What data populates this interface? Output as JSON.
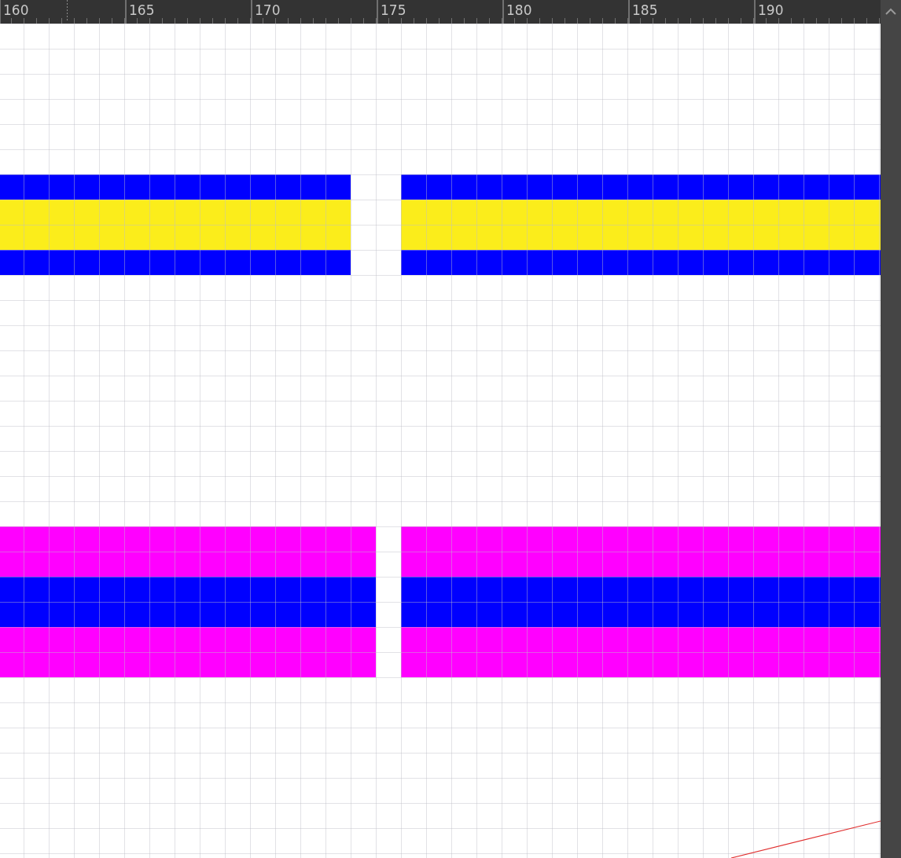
{
  "ruler": {
    "labels": [
      "160",
      "165",
      "170",
      "175",
      "180",
      "185",
      "190"
    ]
  },
  "shapes": [
    {
      "bands": [
        {
          "color": "#0000ff"
        },
        {
          "color": "#fbed1b"
        },
        {
          "color": "#fbed1b"
        },
        {
          "color": "#0000ff"
        }
      ]
    },
    {
      "bands": [
        {
          "color": "#ff00ff"
        },
        {
          "color": "#ff00ff"
        },
        {
          "color": "#0000ff"
        },
        {
          "color": "#0000ff"
        },
        {
          "color": "#ff00ff"
        },
        {
          "color": "#ff00ff"
        }
      ]
    }
  ]
}
